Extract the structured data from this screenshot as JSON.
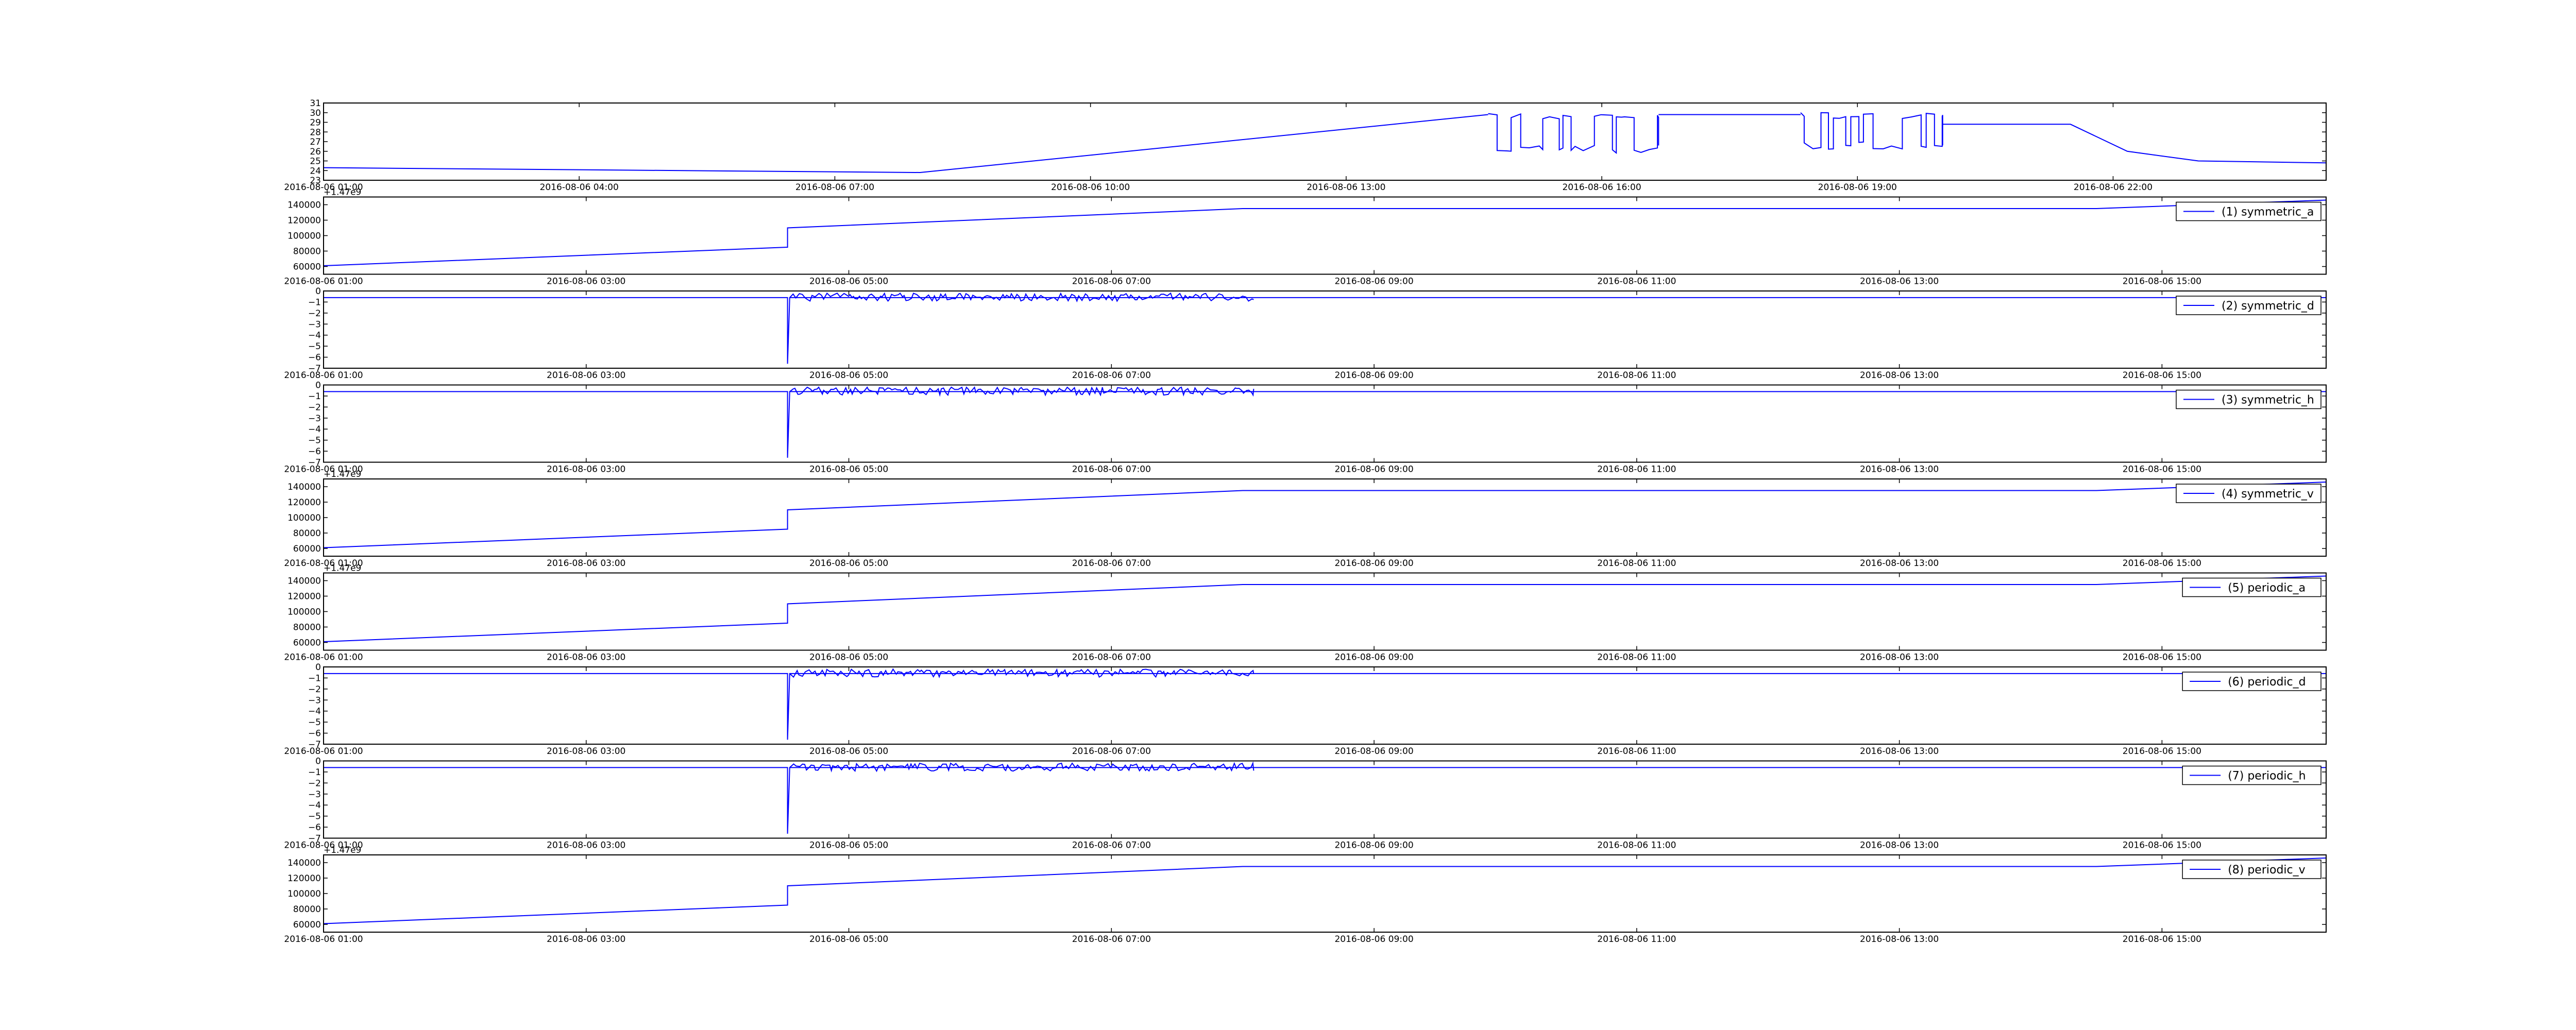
{
  "chart_data": [
    {
      "type": "line",
      "title": "",
      "xlabel": "",
      "ylabel": "",
      "legend": "",
      "legend_position": "none",
      "grid": false,
      "x_range": [
        "2016-08-06 01:00",
        "2016-08-07 00:30"
      ],
      "ylim": [
        23,
        31
      ],
      "y_ticks": [
        23,
        24,
        25,
        26,
        27,
        28,
        29,
        30,
        31
      ],
      "x_ticks": [
        "2016-08-06 01:00",
        "2016-08-06 04:00",
        "2016-08-06 07:00",
        "2016-08-06 10:00",
        "2016-08-06 13:00",
        "2016-08-06 16:00",
        "2016-08-06 19:00",
        "2016-08-06 22:00"
      ],
      "segments": [
        {
          "x": [
            "2016-08-06 01:00",
            "2016-08-06 08:00",
            "2016-08-06 14:40"
          ],
          "y": [
            24.3,
            23.8,
            29.8
          ]
        },
        {
          "style": "oscillate",
          "x": [
            "2016-08-06 14:40",
            "2016-08-06 16:40"
          ],
          "levels": [
            25.8,
            29.9
          ]
        },
        {
          "x": [
            "2016-08-06 16:40",
            "2016-08-06 18:20"
          ],
          "y": [
            29.8,
            29.8
          ]
        },
        {
          "style": "oscillate",
          "x": [
            "2016-08-06 18:20",
            "2016-08-06 20:00"
          ],
          "levels": [
            26.2,
            30.0
          ]
        },
        {
          "x": [
            "2016-08-06 20:00",
            "2016-08-06 21:30",
            "2016-08-06 22:10",
            "2016-08-06 23:00",
            "2016-08-07 00:30"
          ],
          "y": [
            28.8,
            28.8,
            26.0,
            25.0,
            24.8
          ]
        }
      ]
    },
    {
      "type": "line",
      "legend": "(1) symmetric_a",
      "legend_position": "upper-right",
      "grid": false,
      "x_range": [
        "2016-08-06 01:00",
        "2016-08-06 16:15"
      ],
      "ylim": [
        50000,
        150000
      ],
      "y_ticks": [
        60000,
        80000,
        100000,
        120000,
        140000
      ],
      "offset": "+1.47e9",
      "x_ticks": [
        "2016-08-06 01:00",
        "2016-08-06 03:00",
        "2016-08-06 05:00",
        "2016-08-06 07:00",
        "2016-08-06 09:00",
        "2016-08-06 11:00",
        "2016-08-06 13:00",
        "2016-08-06 15:00"
      ],
      "segments": [
        {
          "x": [
            "2016-08-06 01:00",
            "2016-08-06 04:32",
            "2016-08-06 04:32",
            "2016-08-06 08:00",
            "2016-08-06 14:30",
            "2016-08-06 16:15"
          ],
          "y": [
            61000,
            85000,
            110000,
            135000,
            135000,
            146000
          ]
        }
      ]
    },
    {
      "type": "line",
      "legend": "(2) symmetric_d",
      "legend_position": "upper-right",
      "grid": false,
      "x_range": [
        "2016-08-06 01:00",
        "2016-08-06 16:15"
      ],
      "ylim": [
        -7,
        0
      ],
      "y_ticks": [
        -7,
        -6,
        -5,
        -4,
        -3,
        -2,
        -1,
        0
      ],
      "x_ticks": [
        "2016-08-06 01:00",
        "2016-08-06 03:00",
        "2016-08-06 05:00",
        "2016-08-06 07:00",
        "2016-08-06 09:00",
        "2016-08-06 11:00",
        "2016-08-06 13:00",
        "2016-08-06 15:00"
      ],
      "segments": [
        {
          "x": [
            "2016-08-06 01:00",
            "2016-08-06 04:32",
            "2016-08-06 04:32",
            "2016-08-06 04:33",
            "2016-08-06 16:15"
          ],
          "y": [
            -0.6,
            -0.6,
            -6.6,
            -0.6,
            -0.6
          ]
        },
        {
          "style": "noise",
          "x": [
            "2016-08-06 04:33",
            "2016-08-06 08:05"
          ],
          "levels": [
            -0.6,
            -0.2
          ]
        }
      ]
    },
    {
      "type": "line",
      "legend": "(3) symmetric_h",
      "legend_position": "upper-right",
      "grid": false,
      "x_range": [
        "2016-08-06 01:00",
        "2016-08-06 16:15"
      ],
      "ylim": [
        -7,
        0
      ],
      "y_ticks": [
        -7,
        -6,
        -5,
        -4,
        -3,
        -2,
        -1,
        0
      ],
      "x_ticks": [
        "2016-08-06 01:00",
        "2016-08-06 03:00",
        "2016-08-06 05:00",
        "2016-08-06 07:00",
        "2016-08-06 09:00",
        "2016-08-06 11:00",
        "2016-08-06 13:00",
        "2016-08-06 15:00"
      ],
      "segments": [
        {
          "x": [
            "2016-08-06 01:00",
            "2016-08-06 04:32",
            "2016-08-06 04:32",
            "2016-08-06 04:33",
            "2016-08-06 16:15"
          ],
          "y": [
            -0.6,
            -0.6,
            -6.6,
            -0.6,
            -0.6
          ]
        },
        {
          "style": "noise",
          "x": [
            "2016-08-06 04:33",
            "2016-08-06 08:05"
          ],
          "levels": [
            -0.6,
            -0.2
          ]
        }
      ]
    },
    {
      "type": "line",
      "legend": "(4) symmetric_v",
      "legend_position": "upper-right",
      "grid": false,
      "x_range": [
        "2016-08-06 01:00",
        "2016-08-06 16:15"
      ],
      "ylim": [
        50000,
        150000
      ],
      "y_ticks": [
        60000,
        80000,
        100000,
        120000,
        140000
      ],
      "offset": "+1.47e9",
      "x_ticks": [
        "2016-08-06 01:00",
        "2016-08-06 03:00",
        "2016-08-06 05:00",
        "2016-08-06 07:00",
        "2016-08-06 09:00",
        "2016-08-06 11:00",
        "2016-08-06 13:00",
        "2016-08-06 15:00"
      ],
      "segments": [
        {
          "x": [
            "2016-08-06 01:00",
            "2016-08-06 04:32",
            "2016-08-06 04:32",
            "2016-08-06 08:00",
            "2016-08-06 14:30",
            "2016-08-06 16:15"
          ],
          "y": [
            61000,
            85000,
            110000,
            135000,
            135000,
            146000
          ]
        }
      ]
    },
    {
      "type": "line",
      "legend": "(5) periodic_a",
      "legend_position": "upper-right",
      "grid": false,
      "x_range": [
        "2016-08-06 01:00",
        "2016-08-06 16:15"
      ],
      "ylim": [
        50000,
        150000
      ],
      "y_ticks": [
        60000,
        80000,
        100000,
        120000,
        140000
      ],
      "offset": "+1.47e9",
      "x_ticks": [
        "2016-08-06 01:00",
        "2016-08-06 03:00",
        "2016-08-06 05:00",
        "2016-08-06 07:00",
        "2016-08-06 09:00",
        "2016-08-06 11:00",
        "2016-08-06 13:00",
        "2016-08-06 15:00"
      ],
      "segments": [
        {
          "x": [
            "2016-08-06 01:00",
            "2016-08-06 04:32",
            "2016-08-06 04:32",
            "2016-08-06 08:00",
            "2016-08-06 14:30",
            "2016-08-06 16:15"
          ],
          "y": [
            61000,
            85000,
            110000,
            135000,
            135000,
            146000
          ]
        }
      ]
    },
    {
      "type": "line",
      "legend": "(6) periodic_d",
      "legend_position": "upper-right",
      "grid": false,
      "x_range": [
        "2016-08-06 01:00",
        "2016-08-06 16:15"
      ],
      "ylim": [
        -7,
        0
      ],
      "y_ticks": [
        -7,
        -6,
        -5,
        -4,
        -3,
        -2,
        -1,
        0
      ],
      "x_ticks": [
        "2016-08-06 01:00",
        "2016-08-06 03:00",
        "2016-08-06 05:00",
        "2016-08-06 07:00",
        "2016-08-06 09:00",
        "2016-08-06 11:00",
        "2016-08-06 13:00",
        "2016-08-06 15:00"
      ],
      "segments": [
        {
          "x": [
            "2016-08-06 01:00",
            "2016-08-06 04:32",
            "2016-08-06 04:32",
            "2016-08-06 04:33",
            "2016-08-06 16:15"
          ],
          "y": [
            -0.6,
            -0.6,
            -6.6,
            -0.6,
            -0.6
          ]
        },
        {
          "style": "noise",
          "x": [
            "2016-08-06 04:33",
            "2016-08-06 08:05"
          ],
          "levels": [
            -0.6,
            -0.2
          ]
        }
      ]
    },
    {
      "type": "line",
      "legend": "(7) periodic_h",
      "legend_position": "upper-right",
      "grid": false,
      "x_range": [
        "2016-08-06 01:00",
        "2016-08-06 16:15"
      ],
      "ylim": [
        -7,
        0
      ],
      "y_ticks": [
        -7,
        -6,
        -5,
        -4,
        -3,
        -2,
        -1,
        0
      ],
      "x_ticks": [
        "2016-08-06 01:00",
        "2016-08-06 03:00",
        "2016-08-06 05:00",
        "2016-08-06 07:00",
        "2016-08-06 09:00",
        "2016-08-06 11:00",
        "2016-08-06 13:00",
        "2016-08-06 15:00"
      ],
      "segments": [
        {
          "x": [
            "2016-08-06 01:00",
            "2016-08-06 04:32",
            "2016-08-06 04:32",
            "2016-08-06 04:33",
            "2016-08-06 16:15"
          ],
          "y": [
            -0.6,
            -0.6,
            -6.6,
            -0.6,
            -0.6
          ]
        },
        {
          "style": "noise",
          "x": [
            "2016-08-06 04:33",
            "2016-08-06 08:05"
          ],
          "levels": [
            -0.6,
            -0.2
          ]
        }
      ]
    },
    {
      "type": "line",
      "legend": "(8) periodic_v",
      "legend_position": "upper-right",
      "grid": false,
      "x_range": [
        "2016-08-06 01:00",
        "2016-08-06 16:15"
      ],
      "ylim": [
        50000,
        150000
      ],
      "y_ticks": [
        60000,
        80000,
        100000,
        120000,
        140000
      ],
      "offset": "+1.47e9",
      "x_ticks": [
        "2016-08-06 01:00",
        "2016-08-06 03:00",
        "2016-08-06 05:00",
        "2016-08-06 07:00",
        "2016-08-06 09:00",
        "2016-08-06 11:00",
        "2016-08-06 13:00",
        "2016-08-06 15:00"
      ],
      "segments": [
        {
          "x": [
            "2016-08-06 01:00",
            "2016-08-06 04:32",
            "2016-08-06 04:32",
            "2016-08-06 08:00",
            "2016-08-06 14:30",
            "2016-08-06 16:15"
          ],
          "y": [
            61000,
            85000,
            110000,
            135000,
            135000,
            146000
          ]
        }
      ]
    }
  ],
  "colors": {
    "series": "#0000ff",
    "axes": "#000000",
    "background": "#ffffff"
  }
}
